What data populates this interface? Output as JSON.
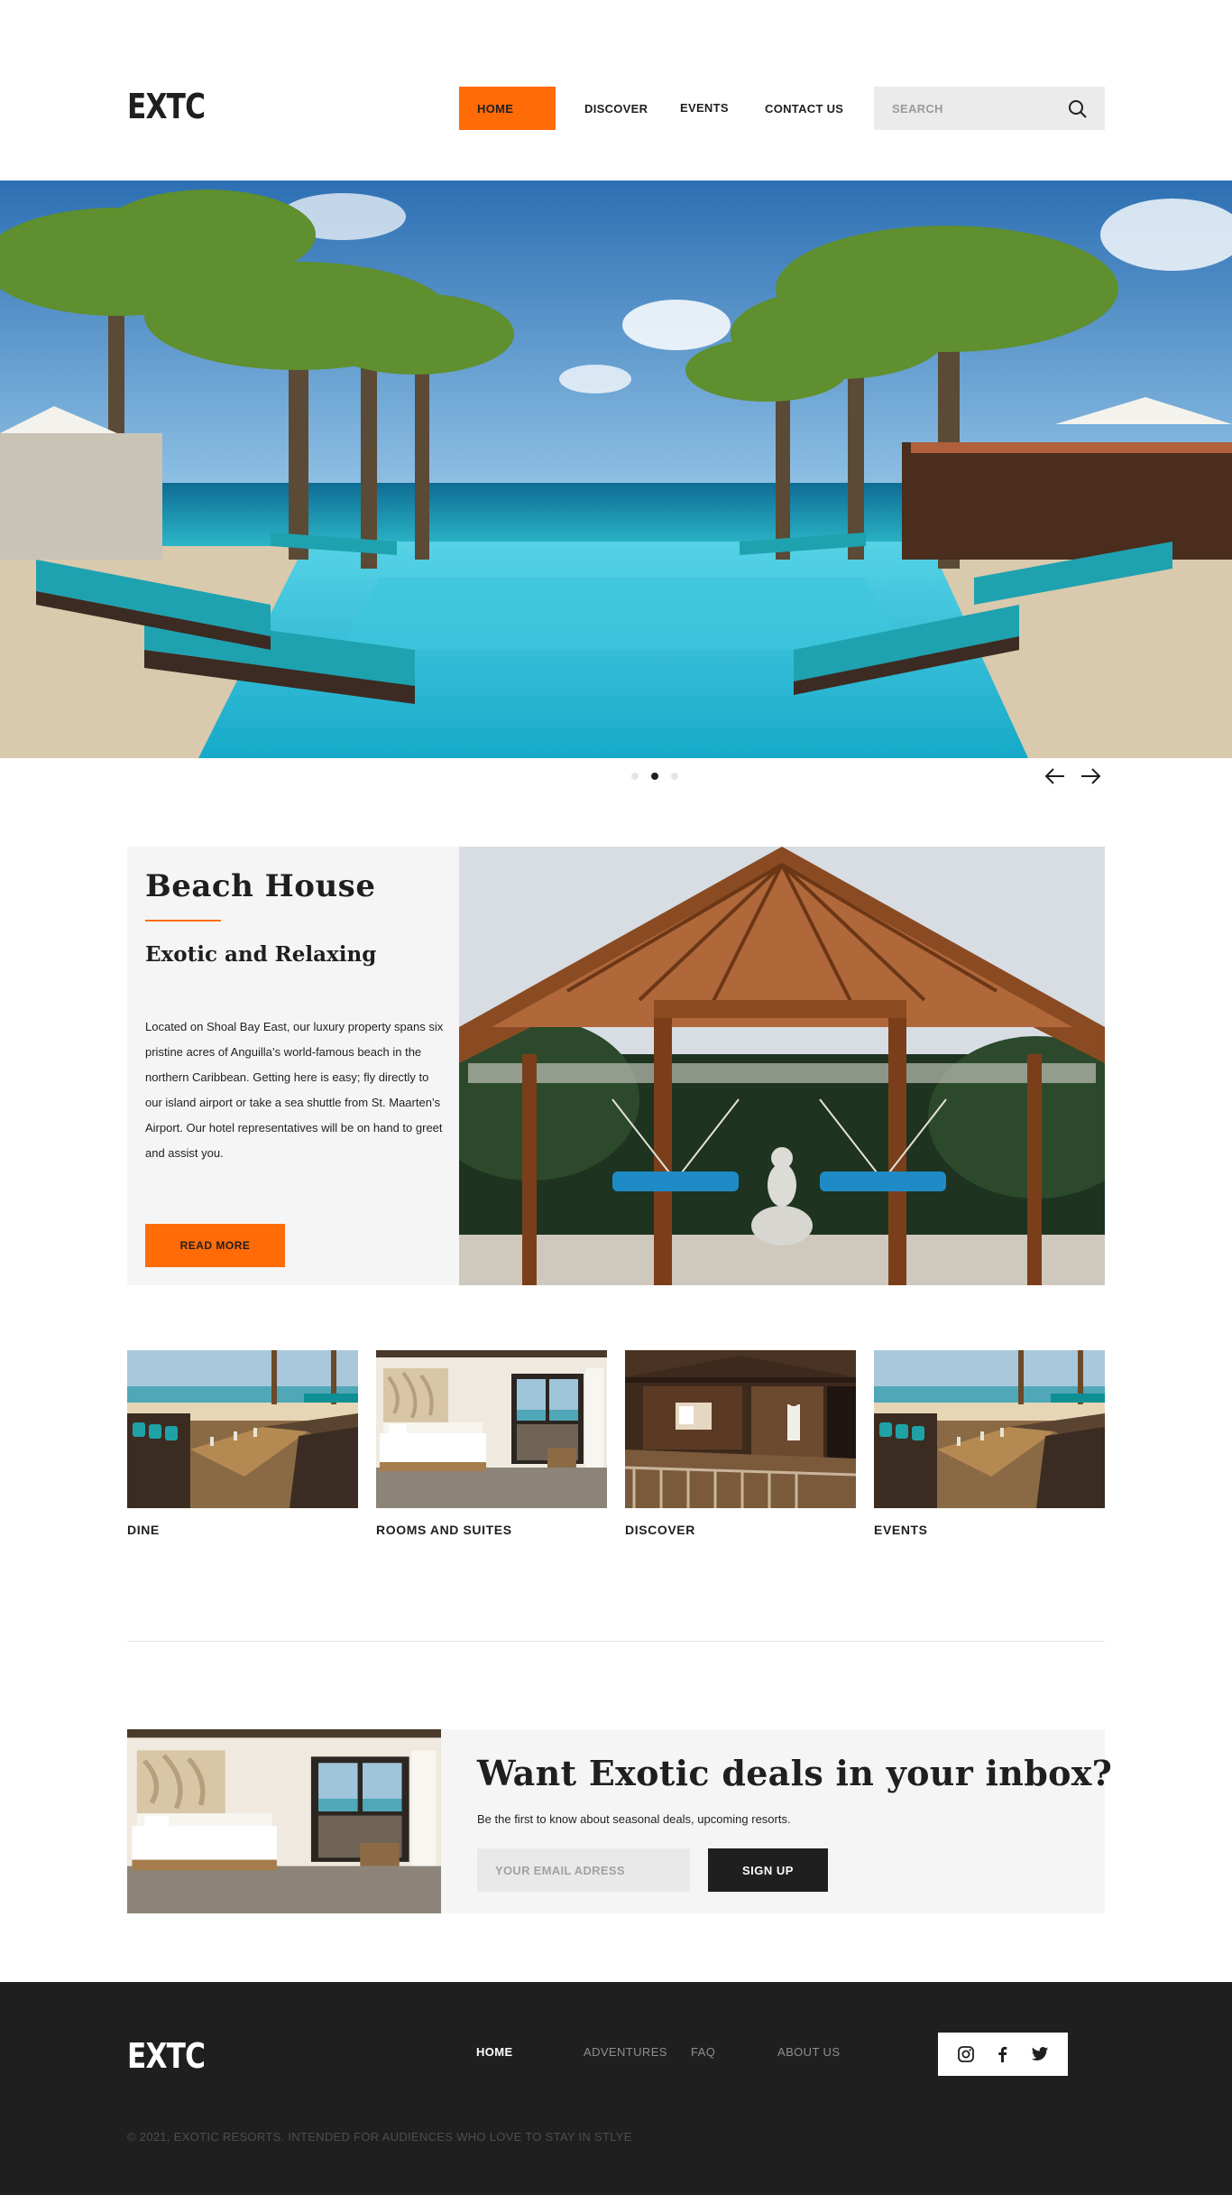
{
  "header": {
    "logo": "EXTC",
    "nav": [
      {
        "label": "HOME",
        "active": true
      },
      {
        "label": "DISCOVER"
      },
      {
        "label": "EVENTS"
      },
      {
        "label": "CONTACT US"
      }
    ],
    "search": {
      "placeholder": "SEARCH",
      "value": "",
      "icon": "search-icon"
    }
  },
  "hero": {
    "image": "resort-infinity-pool-with-palm-trees",
    "slides": 3,
    "active_slide": 2,
    "prev_icon": "arrow-left-icon",
    "next_icon": "arrow-right-icon"
  },
  "feature": {
    "title": "Beach House",
    "subtitle": "Exotic and Relaxing",
    "body": "Located on Shoal Bay East, our luxury property spans six pristine acres of Anguilla’s world-famous beach in the northern Caribbean. Getting here is easy; fly directly to our island airport or take a sea shuttle from St. Maarten’s Airport. Our hotel representatives will be on hand to greet and assist you.",
    "button": "READ MORE",
    "image": "wooden-pavilion-with-hammocks-and-buddha"
  },
  "cards": [
    {
      "label": "DINE",
      "image": "beach-dining-terrace"
    },
    {
      "label": "ROOMS AND SUITES",
      "image": "bedroom-with-sea-view"
    },
    {
      "label": "DISCOVER",
      "image": "wooden-spa-villa"
    },
    {
      "label": "EVENTS",
      "image": "beach-dining-terrace"
    }
  ],
  "newsletter": {
    "image": "bedroom-with-sea-view",
    "title": "Want Exotic deals in your inbox?",
    "subtitle": "Be the first to know about seasonal deals, upcoming resorts.",
    "email_placeholder": "YOUR EMAIL ADRESS",
    "email_value": "",
    "button": "SIGN UP"
  },
  "footer": {
    "logo": "EXTC",
    "links": [
      {
        "label": "HOME",
        "active": true
      },
      {
        "label": "ADVENTURES"
      },
      {
        "label": "FAQ"
      },
      {
        "label": "ABOUT US"
      }
    ],
    "social": [
      "instagram-icon",
      "facebook-icon",
      "twitter-icon"
    ],
    "copyright": "© 2021, EXOTIC RESORTS. INTENDED FOR AUDIENCES WHO LOVE TO STAY IN STLYE"
  },
  "colors": {
    "accent": "#ff6b07",
    "dark": "#1f1f1f",
    "panel": "#f5f5f5",
    "input": "#ebebeb"
  }
}
